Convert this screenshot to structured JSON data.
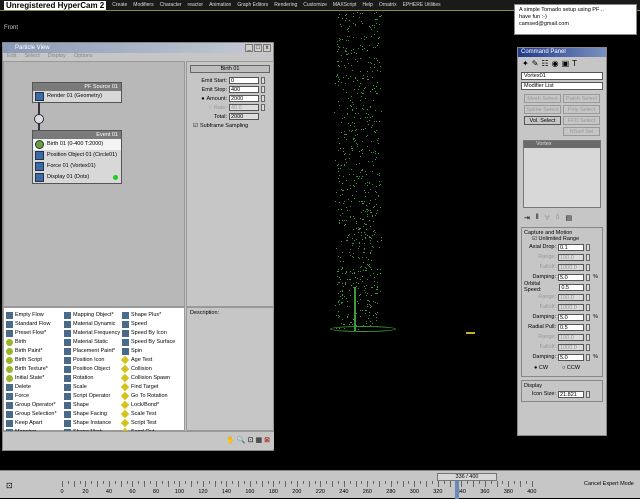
{
  "menubar": {
    "watermark": "Unregistered HyperCam 2",
    "items": [
      "Create",
      "Modifiers",
      "Character",
      "reactor",
      "Animation",
      "Graph Editors",
      "Rendering",
      "Customize",
      "MAXScript",
      "Help",
      "Ornatrix",
      "EPHERE Utilities"
    ]
  },
  "viewport": {
    "label": "Front"
  },
  "note": {
    "lines": [
      "A simple Tornado setup using PF ..",
      "have fun :-)",
      "camsed@gmail.com"
    ]
  },
  "particle_view": {
    "title": "Particle View",
    "menu": [
      "Edit",
      "Select",
      "Display",
      "Options"
    ],
    "source_node": {
      "title": "PF Source 01",
      "rows": [
        "Render 01 (Geometry)"
      ]
    },
    "event_node": {
      "title": "Event 01",
      "rows": [
        "Birth 01 (0-400 T:2000)",
        "Position Object 01 (Circle01)",
        "Force 01 (Vortex01)",
        "Display 01 (Dots)"
      ]
    },
    "params": {
      "title": "Birth 01",
      "emit_start_label": "Emit Start:",
      "emit_start": "0",
      "emit_stop_label": "Emit Stop:",
      "emit_stop": "400",
      "amount_label": "Amount:",
      "amount": "2000",
      "rate_label": "Rate:",
      "rate": "40.0",
      "total_label": "Total:",
      "total": "2000",
      "subframe_label": "Subframe Sampling"
    },
    "description_label": "Description:",
    "depot": [
      [
        "Empty Flow",
        "Standard Flow",
        "Preset Flow*",
        "Birth",
        "Birth Paint*",
        "Birth Script",
        "Birth Texture*",
        "Initial State*",
        "Delete",
        "Force",
        "Group Operator*",
        "Group Selection*",
        "Keep Apart",
        "Mapping"
      ],
      [
        "Mapping Object*",
        "Material Dynamic",
        "Material Frequency",
        "Material Static",
        "Placement Paint*",
        "Position Icon",
        "Position Object",
        "Rotation",
        "Scale",
        "Script Operator",
        "Shape",
        "Shape Facing",
        "Shape Instance",
        "Shape Mark"
      ],
      [
        "Shape Plus*",
        "Speed",
        "Speed By Icon",
        "Speed By Surface",
        "Spin",
        "Age Test",
        "Collision",
        "Collision Spawn",
        "Find Target",
        "Go To Rotation",
        "Lock/Bond*",
        "Scale Test",
        "Script Test",
        "Send Out"
      ]
    ]
  },
  "command_panel": {
    "title": "Command Panel",
    "object_name": "Vortex01",
    "modifier_list": "Modifier List",
    "modifier_buttons": [
      "Mesh Select",
      "Patch Select",
      "Spline Select",
      "Poly Select",
      "Vol. Select",
      "FFD Select",
      "",
      "NSurf Sel"
    ],
    "stack_item": "Vortex",
    "capture": {
      "title": "Capture and Motion",
      "unlimited_range": "Unlimited Range",
      "rows": [
        {
          "label": "Axial Drop:",
          "value": "0.1",
          "dis": false,
          "pct": ""
        },
        {
          "label": "Range:",
          "value": "100.0",
          "dis": true,
          "pct": ""
        },
        {
          "label": "Falloff:",
          "value": "1000.0",
          "dis": true,
          "pct": ""
        },
        {
          "label": "Damping:",
          "value": "5.0",
          "dis": false,
          "pct": "%"
        },
        {
          "label": "Orbital Speed:",
          "value": "0.5",
          "dis": false,
          "pct": ""
        },
        {
          "label": "Range:",
          "value": "100.0",
          "dis": true,
          "pct": ""
        },
        {
          "label": "Falloff:",
          "value": "1000.0",
          "dis": true,
          "pct": ""
        },
        {
          "label": "Damping:",
          "value": "5.0",
          "dis": false,
          "pct": "%"
        },
        {
          "label": "Radial Pull:",
          "value": "0.5",
          "dis": false,
          "pct": ""
        },
        {
          "label": "Range:",
          "value": "100.0",
          "dis": true,
          "pct": ""
        },
        {
          "label": "Falloff:",
          "value": "1000.0",
          "dis": true,
          "pct": ""
        },
        {
          "label": "Damping:",
          "value": "5.0",
          "dis": false,
          "pct": "%"
        }
      ],
      "cw": "CW",
      "ccw": "CCW"
    },
    "display": {
      "title": "Display",
      "icon_size_label": "Icon Size:",
      "icon_size": "21.821"
    }
  },
  "timeline": {
    "slider": "336 / 400",
    "current": 336,
    "max": 400,
    "labels": [
      "0",
      "20",
      "40",
      "60",
      "80",
      "100",
      "120",
      "140",
      "160",
      "180",
      "200",
      "220",
      "240",
      "260",
      "280",
      "300",
      "320",
      "340",
      "360",
      "380",
      "400"
    ],
    "cancel": "Cancel Expert Mode"
  },
  "colors": {
    "particles": "#3c9a3c",
    "title_active": "#223a8a"
  }
}
